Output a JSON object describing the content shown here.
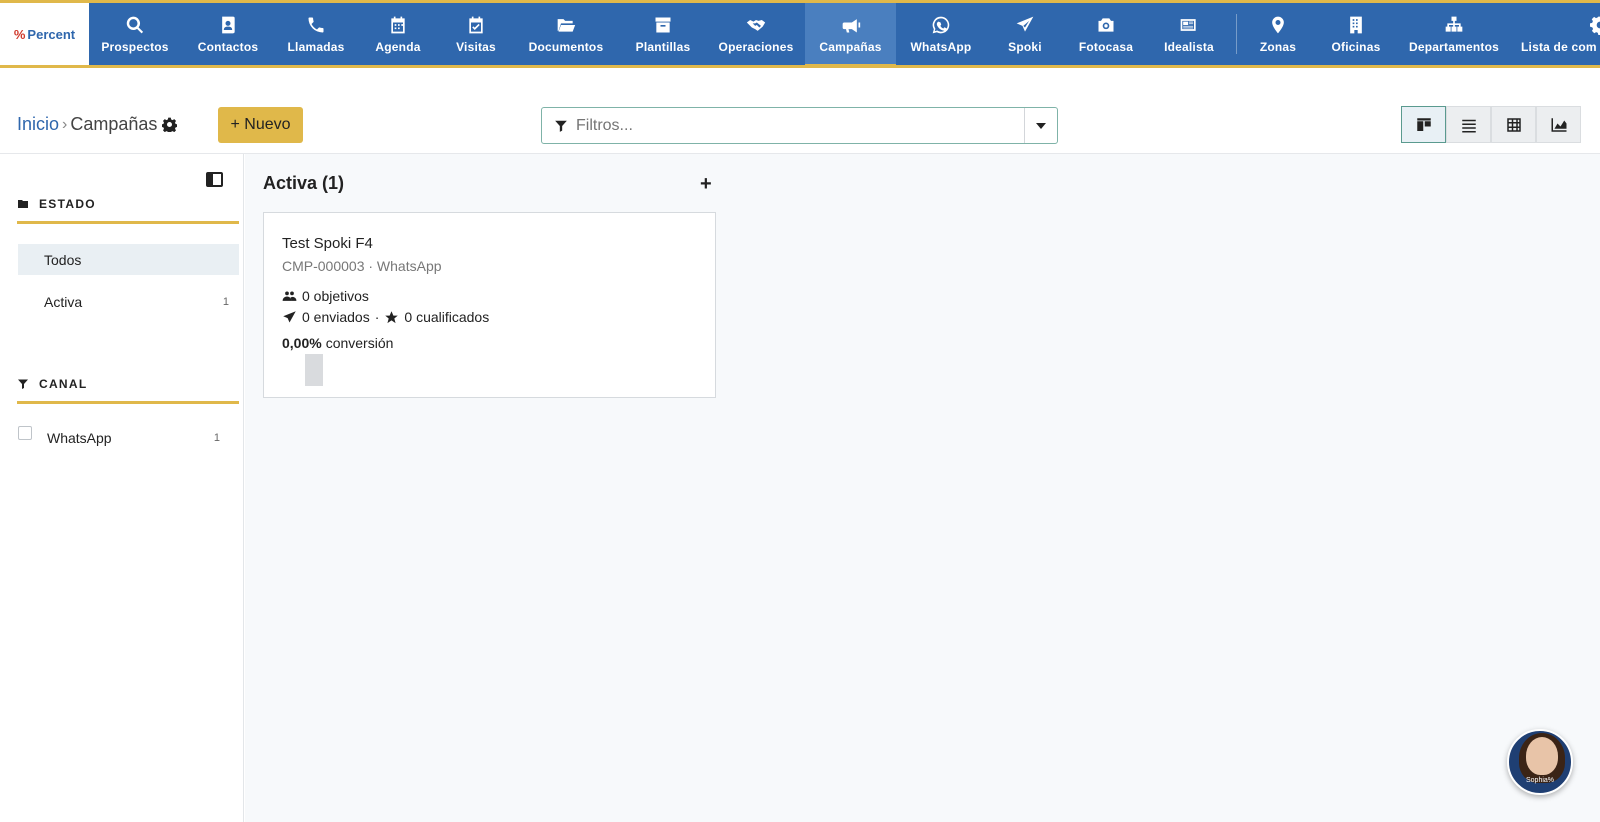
{
  "logo": {
    "mark": "%",
    "text": "Percent"
  },
  "nav": {
    "items": [
      {
        "label": "Prospectos",
        "icon": "search-icon"
      },
      {
        "label": "Contactos",
        "icon": "contact-book-icon"
      },
      {
        "label": "Llamadas",
        "icon": "phone-icon"
      },
      {
        "label": "Agenda",
        "icon": "calendar-icon"
      },
      {
        "label": "Visitas",
        "icon": "calendar-check-icon"
      },
      {
        "label": "Documentos",
        "icon": "folder-open-icon"
      },
      {
        "label": "Plantillas",
        "icon": "archive-box-icon"
      },
      {
        "label": "Operaciones",
        "icon": "handshake-icon"
      },
      {
        "label": "Campañas",
        "icon": "megaphone-icon",
        "active": true
      },
      {
        "label": "WhatsApp",
        "icon": "whatsapp-icon"
      },
      {
        "label": "Spoki",
        "icon": "paper-plane-icon"
      },
      {
        "label": "Fotocasa",
        "icon": "camera-icon"
      },
      {
        "label": "Idealista",
        "icon": "newspaper-icon"
      },
      {
        "label": "Zonas",
        "icon": "map-pin-icon"
      },
      {
        "label": "Oficinas",
        "icon": "building-icon"
      },
      {
        "label": "Departamentos",
        "icon": "sitemap-icon"
      },
      {
        "label": "Lista de com",
        "icon": "gear-icon"
      }
    ]
  },
  "header": {
    "breadcrumb_home": "Inicio",
    "breadcrumb_sep": "›",
    "breadcrumb_current": "Campañas",
    "new_button": "+ Nuevo",
    "filter_placeholder": "Filtros..."
  },
  "sidebar": {
    "estado_title": "ESTADO",
    "estado_items": [
      {
        "label": "Todos",
        "count": ""
      },
      {
        "label": "Activa",
        "count": "1"
      }
    ],
    "canal_title": "CANAL",
    "canal_items": [
      {
        "label": "WhatsApp",
        "count": "1"
      }
    ]
  },
  "board": {
    "column_title": "Activa (1)",
    "add_label": "+",
    "card": {
      "title": "Test Spoki F4",
      "subtitle": "CMP-000003 · WhatsApp",
      "objetivos": "0 objetivos",
      "enviados": "0 enviados",
      "separator": "·",
      "cualificados": "0 cualificados",
      "conversion_value": "0,00%",
      "conversion_label": "conversión"
    }
  },
  "assistant": {
    "label": "Sophia%"
  },
  "colors": {
    "nav_bg": "#2f67ad",
    "accent": "#e0b84a",
    "active_nav": "#4a7fbf"
  }
}
